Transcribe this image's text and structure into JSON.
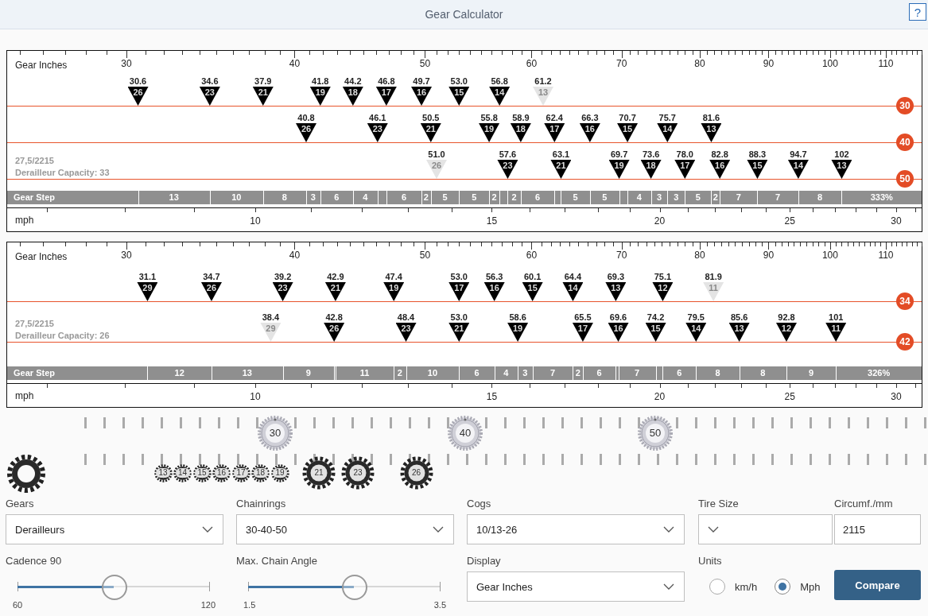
{
  "header": {
    "title": "Gear Calculator",
    "help_button": "?"
  },
  "charts": [
    {
      "axis_label": "Gear Inches",
      "axis_ticks": [
        "30",
        "40",
        "50",
        "60",
        "70",
        "80",
        "90",
        "100",
        "110"
      ],
      "rings": [
        {
          "teeth": "30",
          "gears": [
            {
              "value": "30.6",
              "cog": "26",
              "disabled": false
            },
            {
              "value": "34.6",
              "cog": "23",
              "disabled": false
            },
            {
              "value": "37.9",
              "cog": "21",
              "disabled": false
            },
            {
              "value": "41.8",
              "cog": "19",
              "disabled": false
            },
            {
              "value": "44.2",
              "cog": "18",
              "disabled": false
            },
            {
              "value": "46.8",
              "cog": "17",
              "disabled": false
            },
            {
              "value": "49.7",
              "cog": "16",
              "disabled": false
            },
            {
              "value": "53.0",
              "cog": "15",
              "disabled": false
            },
            {
              "value": "56.8",
              "cog": "14",
              "disabled": false
            },
            {
              "value": "61.2",
              "cog": "13",
              "disabled": true
            }
          ]
        },
        {
          "teeth": "40",
          "gears": [
            {
              "value": "40.8",
              "cog": "26",
              "disabled": false
            },
            {
              "value": "46.1",
              "cog": "23",
              "disabled": false
            },
            {
              "value": "50.5",
              "cog": "21",
              "disabled": false
            },
            {
              "value": "55.8",
              "cog": "19",
              "disabled": false
            },
            {
              "value": "58.9",
              "cog": "18",
              "disabled": false
            },
            {
              "value": "62.4",
              "cog": "17",
              "disabled": false
            },
            {
              "value": "66.3",
              "cog": "16",
              "disabled": false
            },
            {
              "value": "70.7",
              "cog": "15",
              "disabled": false
            },
            {
              "value": "75.7",
              "cog": "14",
              "disabled": false
            },
            {
              "value": "81.6",
              "cog": "13",
              "disabled": false
            }
          ]
        },
        {
          "teeth": "50",
          "gears": [
            {
              "value": "51.0",
              "cog": "26",
              "disabled": true
            },
            {
              "value": "57.6",
              "cog": "23",
              "disabled": false
            },
            {
              "value": "63.1",
              "cog": "21",
              "disabled": false
            },
            {
              "value": "69.7",
              "cog": "19",
              "disabled": false
            },
            {
              "value": "73.6",
              "cog": "18",
              "disabled": false
            },
            {
              "value": "78.0",
              "cog": "17",
              "disabled": false
            },
            {
              "value": "82.8",
              "cog": "16",
              "disabled": false
            },
            {
              "value": "88.3",
              "cog": "15",
              "disabled": false
            },
            {
              "value": "94.7",
              "cog": "14",
              "disabled": false
            },
            {
              "value": "102",
              "cog": "13",
              "disabled": false
            }
          ]
        }
      ],
      "tire": "27,5/2215",
      "capacity": "Derailleur Capacity: 33",
      "gear_step": {
        "label": "Gear Step",
        "steps": [
          {
            "step": "13",
            "gap_before": false
          },
          {
            "step": "10",
            "gap_before": false
          },
          {
            "step": "8",
            "gap_before": false
          },
          {
            "step": "3",
            "gap_before": false
          },
          {
            "step": "6",
            "gap_before": false
          },
          {
            "step": "4",
            "gap_before": false
          },
          {
            "step": "6",
            "gap_before": true
          },
          {
            "step": "2",
            "gap_before": false
          },
          {
            "step": "5",
            "gap_before": false
          },
          {
            "step": "5",
            "gap_before": false
          },
          {
            "step": "2",
            "gap_before": false
          },
          {
            "step": "2",
            "gap_before": true
          },
          {
            "step": "6",
            "gap_before": false
          },
          {
            "step": "5",
            "gap_before": true
          },
          {
            "step": "5",
            "gap_before": false
          },
          {
            "step": "4",
            "gap_before": true
          },
          {
            "step": "3",
            "gap_before": false
          },
          {
            "step": "3",
            "gap_before": false
          },
          {
            "step": "5",
            "gap_before": false
          },
          {
            "step": "2",
            "gap_before": false
          },
          {
            "step": "7",
            "gap_before": false
          },
          {
            "step": "7",
            "gap_before": false
          },
          {
            "step": "8",
            "gap_before": false
          }
        ],
        "total": "333%"
      },
      "speed_label": "mph",
      "speed_ticks": [
        "10",
        "15",
        "20",
        "25",
        "30"
      ]
    },
    {
      "axis_label": "Gear Inches",
      "axis_ticks": [
        "30",
        "40",
        "50",
        "60",
        "70",
        "80",
        "90",
        "100",
        "110"
      ],
      "rings": [
        {
          "teeth": "34",
          "gears": [
            {
              "value": "31.1",
              "cog": "29",
              "disabled": false
            },
            {
              "value": "34.7",
              "cog": "26",
              "disabled": false
            },
            {
              "value": "39.2",
              "cog": "23",
              "disabled": false
            },
            {
              "value": "42.9",
              "cog": "21",
              "disabled": false
            },
            {
              "value": "47.4",
              "cog": "19",
              "disabled": false
            },
            {
              "value": "53.0",
              "cog": "17",
              "disabled": false
            },
            {
              "value": "56.3",
              "cog": "16",
              "disabled": false
            },
            {
              "value": "60.1",
              "cog": "15",
              "disabled": false
            },
            {
              "value": "64.4",
              "cog": "14",
              "disabled": false
            },
            {
              "value": "69.3",
              "cog": "13",
              "disabled": false
            },
            {
              "value": "75.1",
              "cog": "12",
              "disabled": false
            },
            {
              "value": "81.9",
              "cog": "11",
              "disabled": true
            }
          ]
        },
        {
          "teeth": "42",
          "gears": [
            {
              "value": "38.4",
              "cog": "29",
              "disabled": true
            },
            {
              "value": "42.8",
              "cog": "26",
              "disabled": false
            },
            {
              "value": "48.4",
              "cog": "23",
              "disabled": false
            },
            {
              "value": "53.0",
              "cog": "21",
              "disabled": false
            },
            {
              "value": "58.6",
              "cog": "19",
              "disabled": false
            },
            {
              "value": "65.5",
              "cog": "17",
              "disabled": false
            },
            {
              "value": "69.6",
              "cog": "16",
              "disabled": false
            },
            {
              "value": "74.2",
              "cog": "15",
              "disabled": false
            },
            {
              "value": "79.5",
              "cog": "14",
              "disabled": false
            },
            {
              "value": "85.6",
              "cog": "13",
              "disabled": false
            },
            {
              "value": "92.8",
              "cog": "12",
              "disabled": false
            },
            {
              "value": "101",
              "cog": "11",
              "disabled": false
            }
          ]
        }
      ],
      "tire": "27,5/2215",
      "capacity": "Derailleur Capacity: 26",
      "gear_step": {
        "label": "Gear Step",
        "steps": [
          {
            "step": "12",
            "gap_before": false
          },
          {
            "step": "13",
            "gap_before": false
          },
          {
            "step": "9",
            "gap_before": false
          },
          {
            "step": "11",
            "gap_before": true
          },
          {
            "step": "2",
            "gap_before": false
          },
          {
            "step": "10",
            "gap_before": false
          },
          {
            "step": "6",
            "gap_before": true
          },
          {
            "step": "4",
            "gap_before": false
          },
          {
            "step": "3",
            "gap_before": false
          },
          {
            "step": "7",
            "gap_before": false
          },
          {
            "step": "2",
            "gap_before": false
          },
          {
            "step": "6",
            "gap_before": false
          },
          {
            "step": "7",
            "gap_before": true
          },
          {
            "step": "6",
            "gap_before": true
          },
          {
            "step": "8",
            "gap_before": false
          },
          {
            "step": "8",
            "gap_before": false
          },
          {
            "step": "9",
            "gap_before": false
          }
        ],
        "total": "326%"
      },
      "speed_label": "mph",
      "speed_ticks": [
        "10",
        "15",
        "20",
        "25",
        "30"
      ]
    }
  ],
  "drivetrain": {
    "chainrings": [
      "30",
      "40",
      "50"
    ],
    "cogs": [
      "13",
      "14",
      "15",
      "16",
      "17",
      "18",
      "19",
      "21",
      "23",
      "26"
    ]
  },
  "controls": {
    "gears": {
      "label": "Gears",
      "value": "Derailleurs"
    },
    "chainrings": {
      "label": "Chainrings",
      "value": "30-40-50"
    },
    "cogs": {
      "label": "Cogs",
      "value": "10/13-26"
    },
    "tire_size": {
      "label": "Tire Size"
    },
    "circumference": {
      "label": "Circumf./mm",
      "value": "2115"
    },
    "cadence": {
      "label": "Cadence 90",
      "level": 0.5,
      "min": "60",
      "max": "120"
    },
    "chain_angle": {
      "label": "Max. Chain Angle",
      "level": 0.55,
      "min": "1.5",
      "max": "3.5"
    },
    "display": {
      "label": "Display",
      "value": "Gear Inches"
    },
    "units": {
      "label": "Units",
      "options": [
        {
          "label": "km/h",
          "selected": false
        },
        {
          "label": "Mph",
          "selected": true
        }
      ]
    },
    "compare_button": "Compare"
  }
}
